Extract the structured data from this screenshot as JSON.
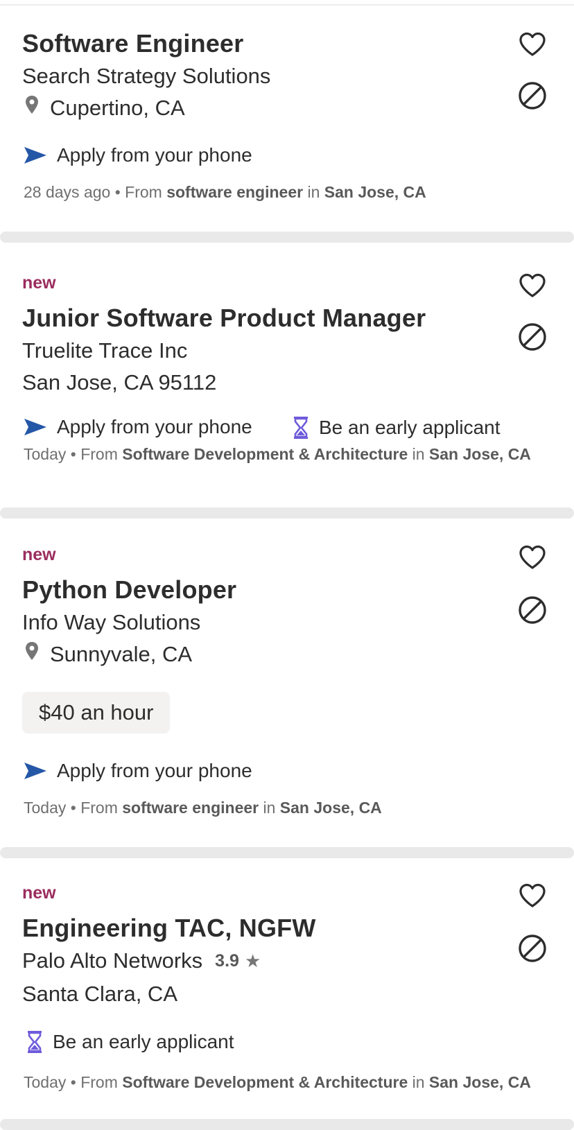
{
  "jobs": [
    {
      "is_new": false,
      "title": "Software Engineer",
      "company": "Search Strategy Solutions",
      "location": "Cupertino, CA",
      "features": [
        "Apply from your phone"
      ],
      "posted": "28 days ago",
      "from_word": "• From",
      "search_term": "software engineer",
      "in_word": "in",
      "search_location": "San Jose, CA"
    },
    {
      "is_new": true,
      "new_label": "new",
      "title": "Junior Software Product Manager",
      "company": "Truelite Trace Inc",
      "location": "San Jose, CA 95112",
      "features": [
        "Apply from your phone",
        "Be an early applicant"
      ],
      "posted": "Today",
      "from_word": "• From",
      "search_term": "Software Development & Architecture",
      "in_word": "in",
      "search_location": "San Jose, CA"
    },
    {
      "is_new": true,
      "new_label": "new",
      "title": "Python Developer",
      "company": "Info Way Solutions",
      "location": "Sunnyvale, CA",
      "salary": "$40 an hour",
      "features": [
        "Apply from your phone"
      ],
      "posted": "Today",
      "from_word": "• From",
      "search_term": "software engineer",
      "in_word": "in",
      "search_location": "San Jose, CA"
    },
    {
      "is_new": true,
      "new_label": "new",
      "title": "Engineering TAC, NGFW",
      "company": "Palo Alto Networks",
      "rating": "3.9",
      "location": "Santa Clara, CA",
      "features": [
        "Be an early applicant"
      ],
      "posted": "Today",
      "from_word": "• From",
      "search_term": "Software Development & Architecture",
      "in_word": "in",
      "search_location": "San Jose, CA"
    }
  ],
  "icons": {
    "save": "heart-icon",
    "dismiss": "not-interested-icon",
    "pin": "location-pin-icon",
    "apply": "send-icon",
    "early": "hourglass-icon",
    "rating_star": "star-icon"
  },
  "colors": {
    "new_label": "#9b2d5e",
    "send_icon": "#2557a7",
    "hourglass_icon": "#6e5bdb",
    "separator": "#e9e9e9"
  }
}
